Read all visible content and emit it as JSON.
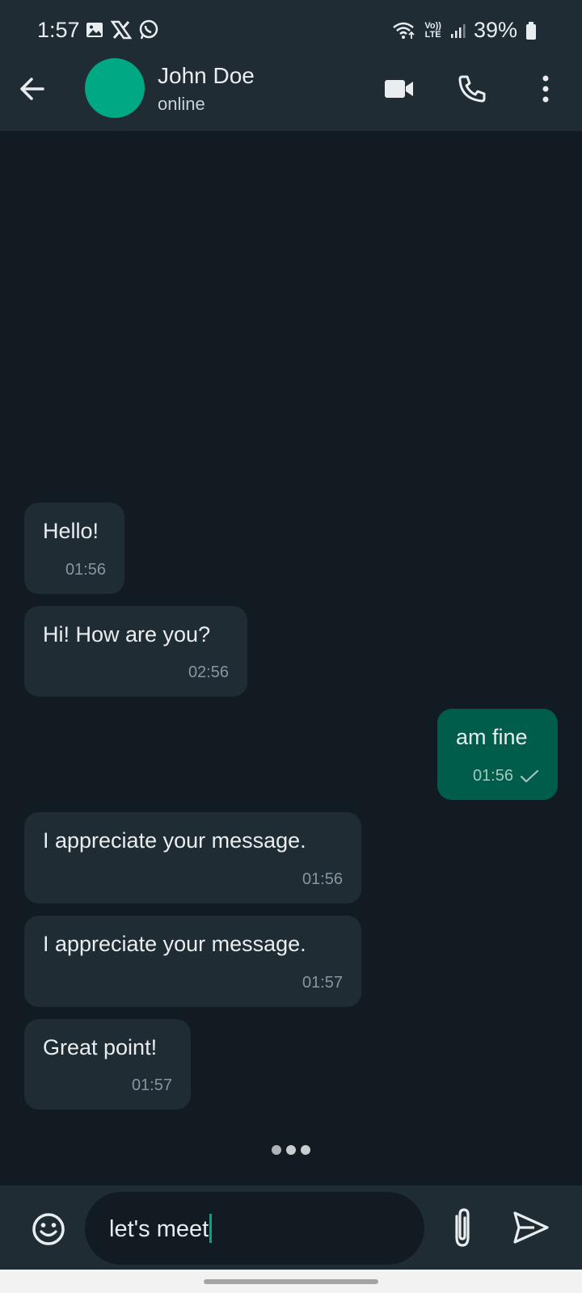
{
  "status_bar": {
    "time": "1:57",
    "battery": "39%",
    "network_top": "Vo))",
    "network_bottom": "LTE",
    "left_icons": [
      "gallery-icon",
      "x-icon",
      "whatsapp-icon"
    ],
    "right_icons": [
      "wifi-icon",
      "signal-icon",
      "battery-icon"
    ]
  },
  "header": {
    "contact_name": "John Doe",
    "contact_status": "online",
    "avatar_color": "#00A884",
    "actions": [
      "video-call-icon",
      "phone-icon",
      "more-vert-icon"
    ]
  },
  "messages": [
    {
      "direction": "incoming",
      "text": "Hello!",
      "time": "01:56"
    },
    {
      "direction": "incoming",
      "text": "Hi! How are you?",
      "time": "02:56"
    },
    {
      "direction": "outgoing",
      "text": "am fine",
      "time": "01:56",
      "status": "sent"
    },
    {
      "direction": "incoming",
      "text": "I appreciate your message.",
      "time": "01:56"
    },
    {
      "direction": "incoming",
      "text": "I appreciate your message.",
      "time": "01:57"
    },
    {
      "direction": "incoming",
      "text": "Great point!",
      "time": "01:57"
    }
  ],
  "typing_indicator": true,
  "composer": {
    "value": "let's meet",
    "icons": [
      "emoji-icon",
      "attach-icon",
      "send-icon"
    ]
  },
  "colors": {
    "background": "#121B22",
    "bar": "#202C33",
    "incoming_bubble": "#202C33",
    "outgoing_bubble": "#005C4B",
    "accent": "#00A884"
  }
}
